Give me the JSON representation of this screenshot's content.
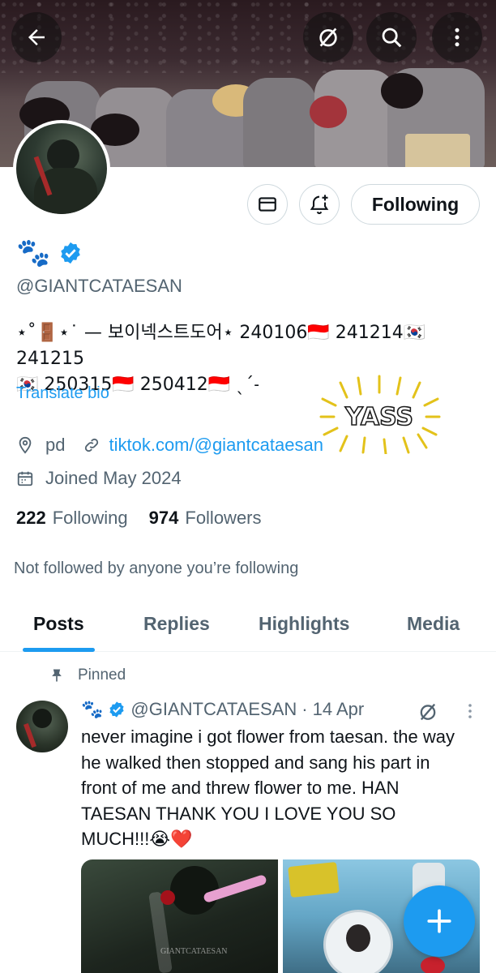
{
  "header": {
    "back_icon": "back-arrow-icon",
    "icons": [
      "hide-icon",
      "search-icon",
      "more-vertical-icon"
    ]
  },
  "profile": {
    "name_emoji": "🐾",
    "verified_icon": "verified-badge-icon",
    "handle": "@GIANTCATAESAN",
    "bio_line1": "⋆˚🚪⋆˙ — 보이넥스트도어⋆ 240106🇮🇩 241214🇰🇷 241215",
    "bio_line2": "🇰🇷 250315🇮🇩 250412🇮🇩 ˎˊ˗",
    "translate_label": "Translate bio",
    "location": "pd",
    "website": "tiktok.com/@giantcataesan",
    "joined": "Joined May 2024",
    "following_count": "222",
    "following_label": "Following",
    "followers_count": "974",
    "followers_label": "Followers",
    "not_followed_text": "Not followed by anyone you’re following",
    "sticker_text": "YASS"
  },
  "actions": {
    "message_icon": "message-icon",
    "notify_icon": "bell-plus-icon",
    "follow_label": "Following"
  },
  "tabs": [
    {
      "label": "Posts"
    },
    {
      "label": "Replies"
    },
    {
      "label": "Highlights"
    },
    {
      "label": "Media"
    }
  ],
  "post": {
    "pinned_label": "Pinned",
    "author_emoji": "🐾",
    "handle": "@GIANTCATAESAN",
    "separator": "·",
    "date": "14 Apr",
    "text": "never imagine i got flower from taesan. the way he walked then stopped and sang his part in front of me and threw flower to me. HAN TAESAN THANK YOU I LOVE YOU SO MUCH!!!😭❤️",
    "media_watermark": "GIANTCATAESAN"
  },
  "fab_icon": "plus-icon"
}
